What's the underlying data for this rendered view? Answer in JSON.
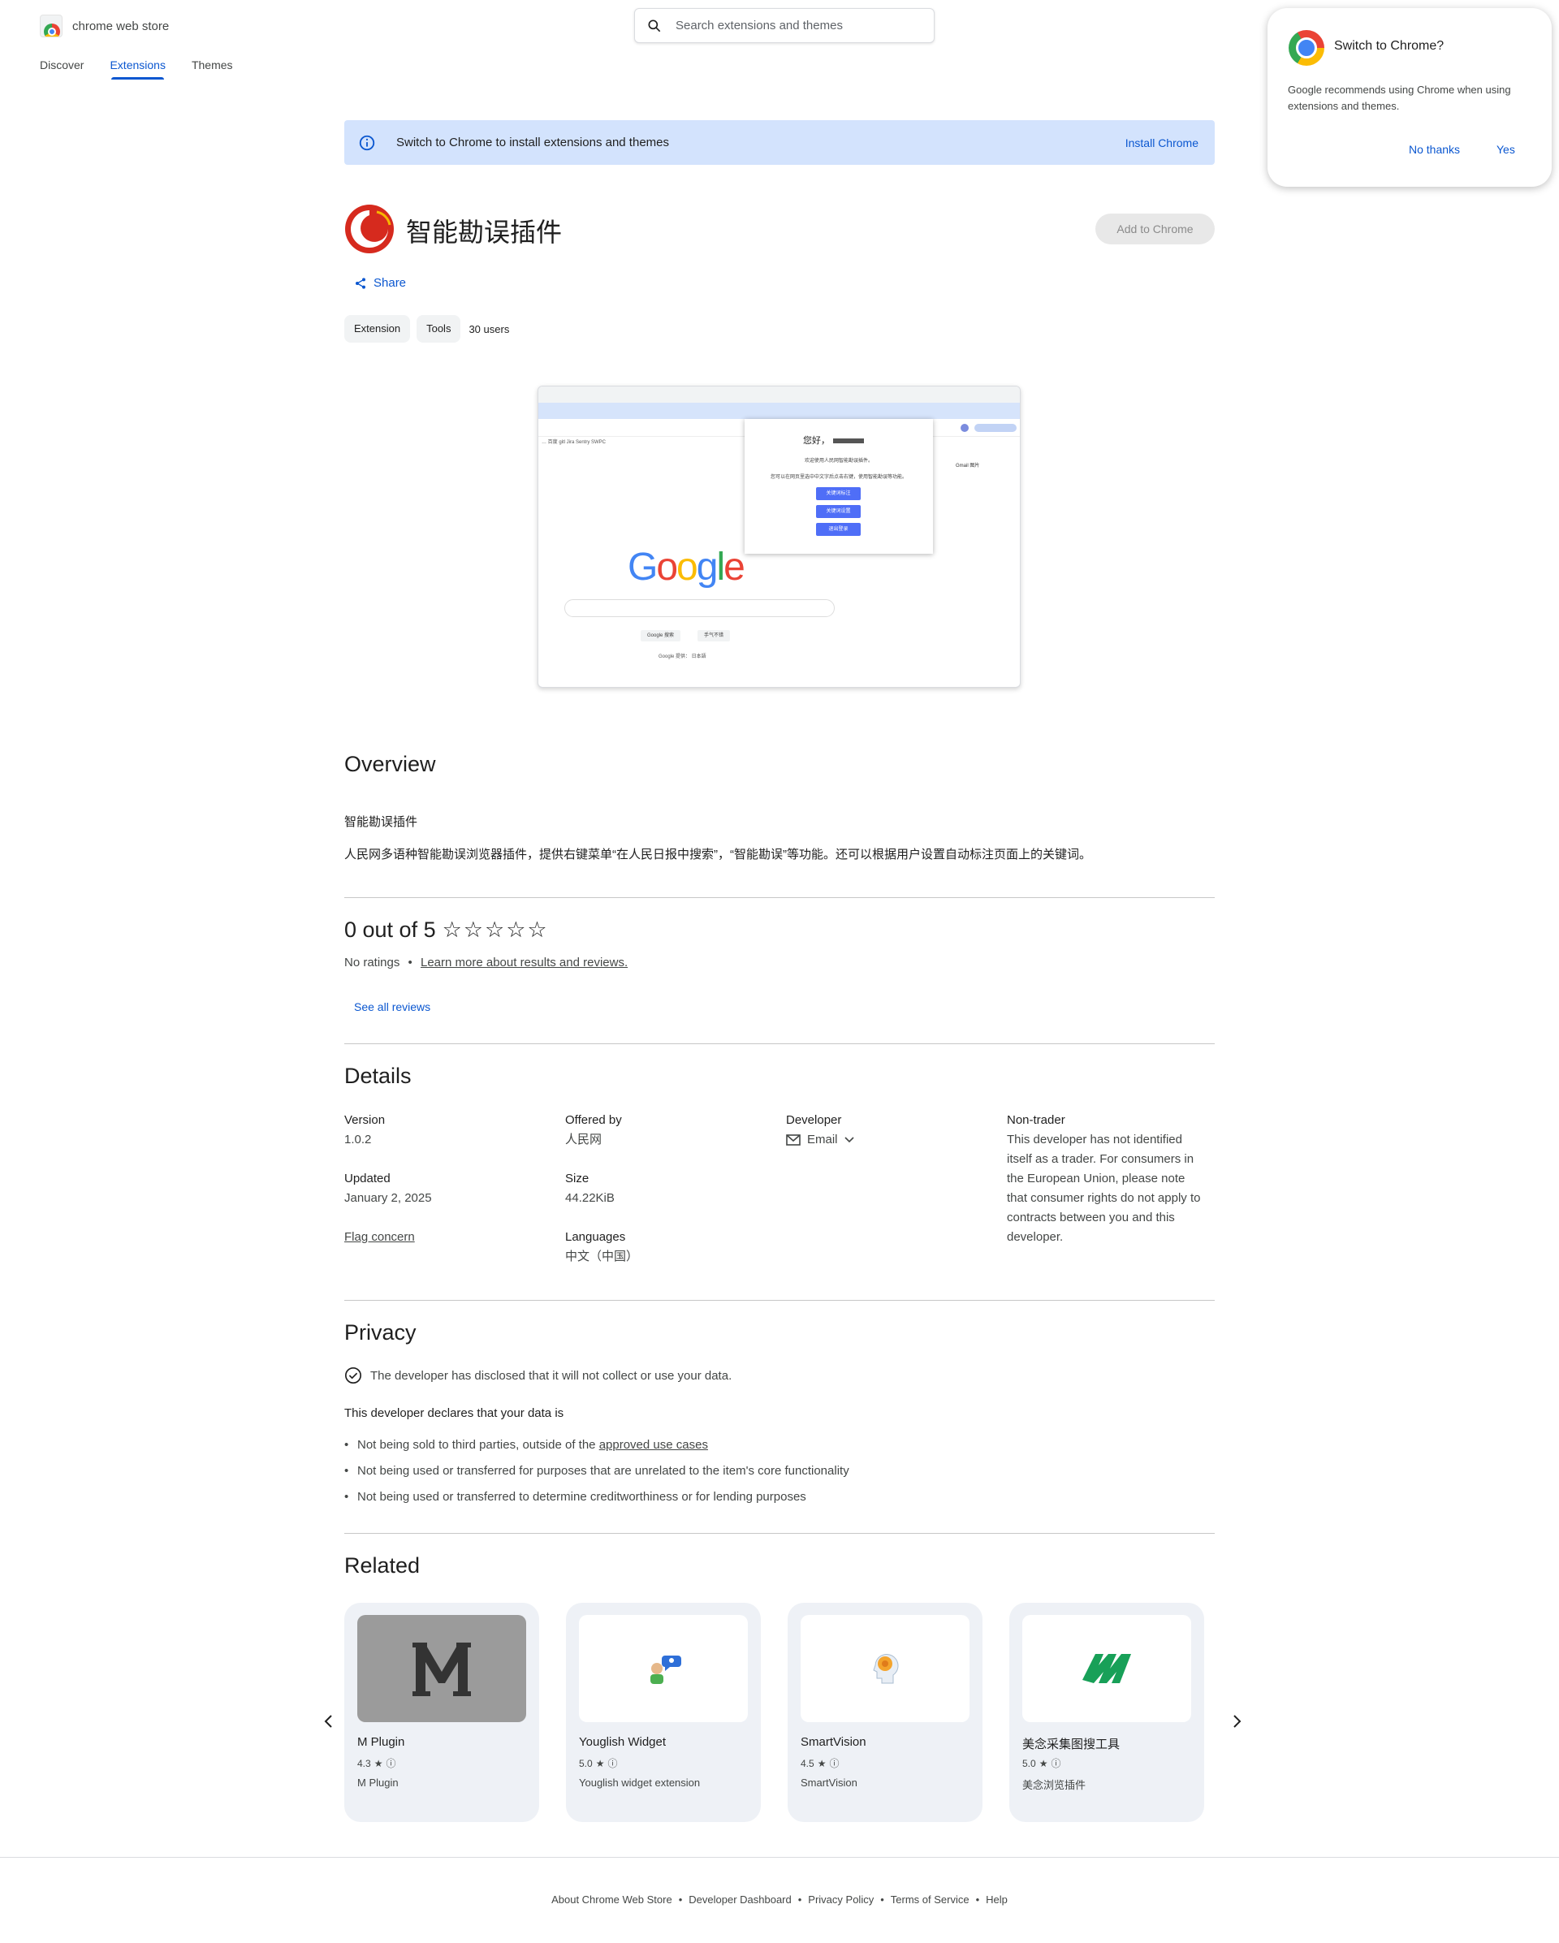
{
  "header": {
    "store_name": "chrome web store",
    "search_placeholder": "Search extensions and themes",
    "nav": [
      "Discover",
      "Extensions",
      "Themes"
    ],
    "active_nav": "Extensions"
  },
  "popup": {
    "title": "Switch to Chrome?",
    "body": "Google recommends using Chrome when using extensions and themes.",
    "no_label": "No thanks",
    "yes_label": "Yes"
  },
  "banner": {
    "text": "Switch to Chrome to install extensions and themes",
    "link": "Install Chrome"
  },
  "extension": {
    "name": "智能勘误插件",
    "add_button": "Add to Chrome",
    "share": "Share",
    "chips": [
      "Extension",
      "Tools"
    ],
    "users": "30 users"
  },
  "screenshot": {
    "popup_heading": "您好，",
    "popup_line1": "欢迎使用人民网智能勘误插件。",
    "popup_line2": "您可以在网页里选中中文字后点击右键，使用智能勘误等功能。",
    "popup_buttons": [
      "关键词标注",
      "关键词设置",
      "退出登录"
    ],
    "google": [
      "G",
      "o",
      "o",
      "g",
      "l",
      "e"
    ],
    "search_buttons": [
      "Google 搜索",
      "手气不错"
    ],
    "offered_in": "Google 提供：  日本語",
    "top_right": "Gmail  图片",
    "bookmarks": "… 百度  gitl  Jira  Sentry  SWPC"
  },
  "overview": {
    "title": "Overview",
    "name": "智能勘误插件",
    "description": "人民网多语种智能勘误浏览器插件，提供右键菜单“在人民日报中搜索”，“智能勘误”等功能。还可以根据用户设置自动标注页面上的关键词。"
  },
  "rating": {
    "headline": "0 out of 5",
    "stars": "☆☆☆☆☆",
    "no_ratings": "No ratings",
    "learn_more": "Learn more about results and reviews.",
    "see_all": "See all reviews"
  },
  "details": {
    "title": "Details",
    "version_label": "Version",
    "version": "1.0.2",
    "updated_label": "Updated",
    "updated": "January 2, 2025",
    "flag": "Flag concern",
    "offered_label": "Offered by",
    "offered": "人民网",
    "size_label": "Size",
    "size": "44.22KiB",
    "languages_label": "Languages",
    "languages": "中文（中国）",
    "developer_label": "Developer",
    "email": "Email",
    "nontrader_label": "Non-trader",
    "nontrader_text": "This developer has not identified itself as a trader. For consumers in the European Union, please note that consumer rights do not apply to contracts between you and this developer."
  },
  "privacy": {
    "title": "Privacy",
    "disclosed": "The developer has disclosed that it will not collect or use your data.",
    "declares": "This developer declares that your data is",
    "item1_prefix": "Not being sold to third parties, outside of the ",
    "item1_link": "approved use cases",
    "item2": "Not being used or transferred for purposes that are unrelated to the item's core functionality",
    "item3": "Not being used or transferred to determine creditworthiness or for lending purposes"
  },
  "related": {
    "title": "Related",
    "items": [
      {
        "name": "M Plugin",
        "rating": "4.3",
        "desc": "M Plugin"
      },
      {
        "name": "Youglish Widget",
        "rating": "5.0",
        "desc": "Youglish widget extension"
      },
      {
        "name": "SmartVision",
        "rating": "4.5",
        "desc": "SmartVision"
      },
      {
        "name": "美念采集图搜工具",
        "rating": "5.0",
        "desc": "美念浏览插件"
      }
    ]
  },
  "footer": {
    "links": [
      "About Chrome Web Store",
      "Developer Dashboard",
      "Privacy Policy",
      "Terms of Service",
      "Help"
    ]
  },
  "colors": {
    "accent": "#0b57d0",
    "banner_bg": "#d3e3fd",
    "card_bg": "#eef1f6"
  }
}
